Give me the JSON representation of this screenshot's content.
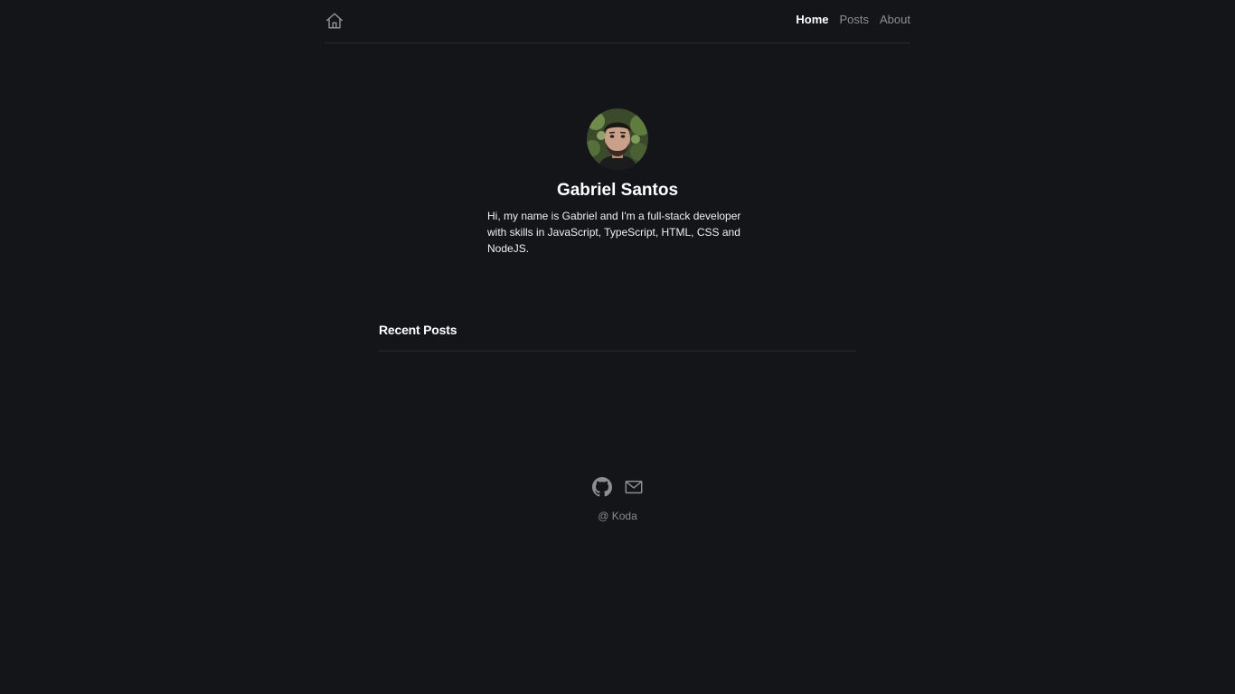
{
  "header": {
    "home_icon": "home-icon",
    "nav": [
      {
        "label": "Home",
        "active": true
      },
      {
        "label": "Posts",
        "active": false
      },
      {
        "label": "About",
        "active": false
      }
    ]
  },
  "profile": {
    "avatar_icon": "avatar",
    "name": "Gabriel Santos",
    "bio": "Hi, my name is Gabriel and I'm a full-stack developer with skills in JavaScript, TypeScript, HTML, CSS and NodeJS."
  },
  "recent_posts": {
    "title": "Recent Posts"
  },
  "footer": {
    "icons": [
      "github-icon",
      "mail-icon"
    ],
    "copyright": "@ Koda"
  },
  "colors": {
    "background": "#141518",
    "text": "#ffffff",
    "muted": "#8d8e93",
    "divider": "#2a2b2f"
  }
}
